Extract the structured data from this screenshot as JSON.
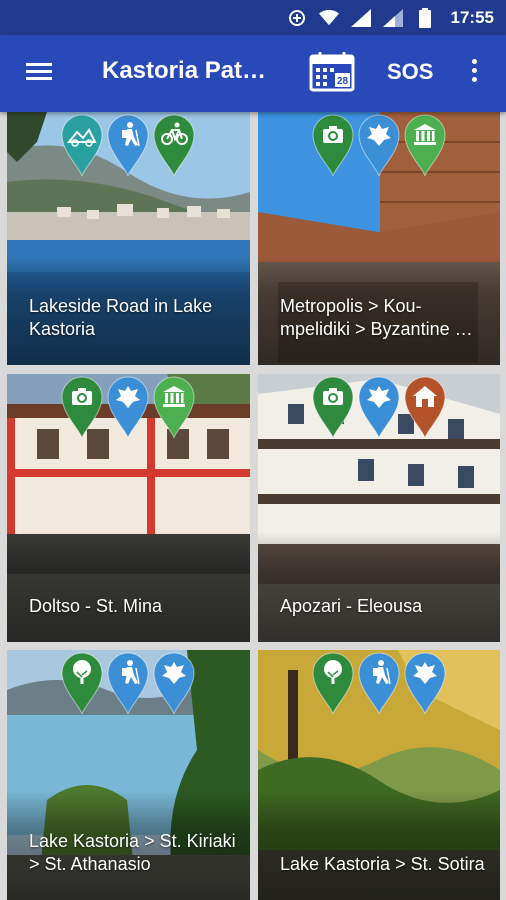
{
  "status_bar": {
    "time": "17:55"
  },
  "app_bar": {
    "title": "Kastoria Pat…",
    "calendar_day": "28",
    "sos_label": "SOS"
  },
  "colors": {
    "status_bar": "#213a8f",
    "app_bar": "#2a49b9",
    "pin_green": "#2e8b3e",
    "pin_teal": "#2aa0a0",
    "pin_blue": "#3a8fd6",
    "pin_light_green": "#4caf50",
    "pin_brown": "#b4522a"
  },
  "cards": [
    {
      "label": "Lakeside Road in Lake Kastoria",
      "pins": [
        {
          "icon": "bike-mountain-icon",
          "color": "#2aa0a0"
        },
        {
          "icon": "hiker-icon",
          "color": "#3a8fd6"
        },
        {
          "icon": "bicycle-icon",
          "color": "#2e8b3e"
        }
      ]
    },
    {
      "label": "Metropolis > Kou-mpelidiki > Byzantine …",
      "pins": [
        {
          "icon": "camera-icon",
          "color": "#2e8b3e"
        },
        {
          "icon": "byzantine-eagle-icon",
          "color": "#3a8fd6"
        },
        {
          "icon": "museum-icon",
          "color": "#4caf50"
        }
      ]
    },
    {
      "label": "Doltso - St. Mina",
      "pins": [
        {
          "icon": "camera-icon",
          "color": "#2e8b3e"
        },
        {
          "icon": "byzantine-eagle-icon",
          "color": "#3a8fd6"
        },
        {
          "icon": "museum-icon",
          "color": "#4caf50"
        }
      ]
    },
    {
      "label": "Apozari - Eleousa",
      "pins": [
        {
          "icon": "camera-icon",
          "color": "#2e8b3e"
        },
        {
          "icon": "byzantine-eagle-icon",
          "color": "#3a8fd6"
        },
        {
          "icon": "house-icon",
          "color": "#b4522a"
        }
      ]
    },
    {
      "label": "Lake Kastoria > St. Kiriaki > St. Athanasio",
      "pins": [
        {
          "icon": "tree-icon",
          "color": "#2e8b3e"
        },
        {
          "icon": "hiker-icon",
          "color": "#3a8fd6"
        },
        {
          "icon": "byzantine-eagle-icon",
          "color": "#3a8fd6"
        }
      ]
    },
    {
      "label": "Lake Kastoria > St. Sotira",
      "pins": [
        {
          "icon": "tree-icon",
          "color": "#2e8b3e"
        },
        {
          "icon": "hiker-icon",
          "color": "#3a8fd6"
        },
        {
          "icon": "byzantine-eagle-icon",
          "color": "#3a8fd6"
        }
      ]
    }
  ]
}
